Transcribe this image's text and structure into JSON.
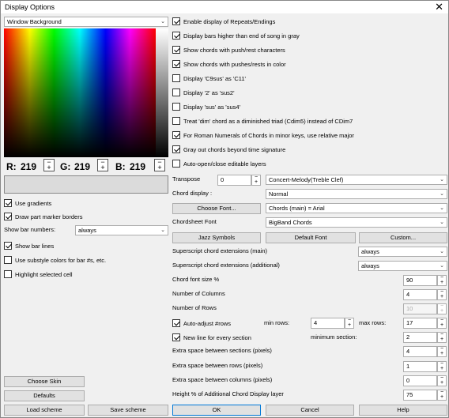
{
  "title": "Display Options",
  "left": {
    "element_combo": "Window Background",
    "rgb": {
      "r_label": "R:",
      "r": "219",
      "g_label": "G:",
      "g": "219",
      "b_label": "B:",
      "b": "219"
    },
    "use_gradients": "Use gradients",
    "draw_part_marker": "Draw part marker borders",
    "show_bar_numbers_label": "Show bar numbers:",
    "show_bar_numbers_value": "always",
    "show_bar_lines": "Show bar lines",
    "use_substyle": "Use substyle colors for bar #s, etc.",
    "highlight_cell": "Highlight selected cell",
    "choose_skin": "Choose Skin",
    "defaults": "Defaults",
    "load_scheme": "Load scheme",
    "save_scheme": "Save scheme"
  },
  "checks": [
    {
      "label": "Enable display of Repeats/Endings",
      "on": true
    },
    {
      "label": "Display bars higher than end of song in gray",
      "on": true
    },
    {
      "label": "Show chords with push/rest characters",
      "on": true
    },
    {
      "label": "Show chords with pushes/rests in color",
      "on": true
    },
    {
      "label": "Display 'C9sus' as 'C11'",
      "on": false
    },
    {
      "label": "Display '2' as 'sus2'",
      "on": false
    },
    {
      "label": "Display 'sus' as 'sus4'",
      "on": false
    },
    {
      "label": "Treat 'dim' chord as a diminished triad (Cdim5) instead of CDim7",
      "on": false
    },
    {
      "label": "For Roman Numerals of Chords in minor keys, use relative major",
      "on": true
    },
    {
      "label": "Gray out chords beyond time signature",
      "on": true
    },
    {
      "label": "Auto-open/close editable layers",
      "on": false
    }
  ],
  "right": {
    "transpose_label": "Transpose",
    "transpose_value": "0",
    "transpose_combo": "Concert-Melody(Treble Clef)",
    "chord_display_label": "Chord display :",
    "chord_display_value": "Normal",
    "choose_font": "Choose Font...",
    "chord_font_combo": "Chords (main) = Arial",
    "chordsheet_font_label": "Chordsheet Font",
    "chordsheet_font_value": "BigBand Chords",
    "jazz_symbols": "Jazz Symbols",
    "default_font": "Default Font",
    "custom": "Custom...",
    "superscript_main_label": "Superscript chord extensions (main)",
    "superscript_main_value": "always",
    "superscript_add_label": "Superscript chord extensions (additional)",
    "superscript_add_value": "always",
    "chord_font_size_label": "Chord font size %",
    "chord_font_size_value": "90",
    "num_columns_label": "Number of Columns",
    "num_columns_value": "4",
    "num_rows_label": "Number of Rows",
    "num_rows_value": "10",
    "auto_adjust_label": "Auto-adjust #rows",
    "min_rows_label": "min rows:",
    "min_rows_value": "4",
    "max_rows_label": "max rows:",
    "max_rows_value": "17",
    "new_line_label": "New line for every section",
    "min_section_label": "minimum section:",
    "min_section_value": "2",
    "extra_sections_label": "Extra space between sections (pixels)",
    "extra_sections_value": "4",
    "extra_rows_label": "Extra space between rows (pixels)",
    "extra_rows_value": "1",
    "extra_columns_label": "Extra space between columns (pixels)",
    "extra_columns_value": "0",
    "height_pct_label": "Height % of Additional Chord Display layer",
    "height_pct_value": "75"
  },
  "footer": {
    "ok": "OK",
    "cancel": "Cancel",
    "help": "Help"
  }
}
